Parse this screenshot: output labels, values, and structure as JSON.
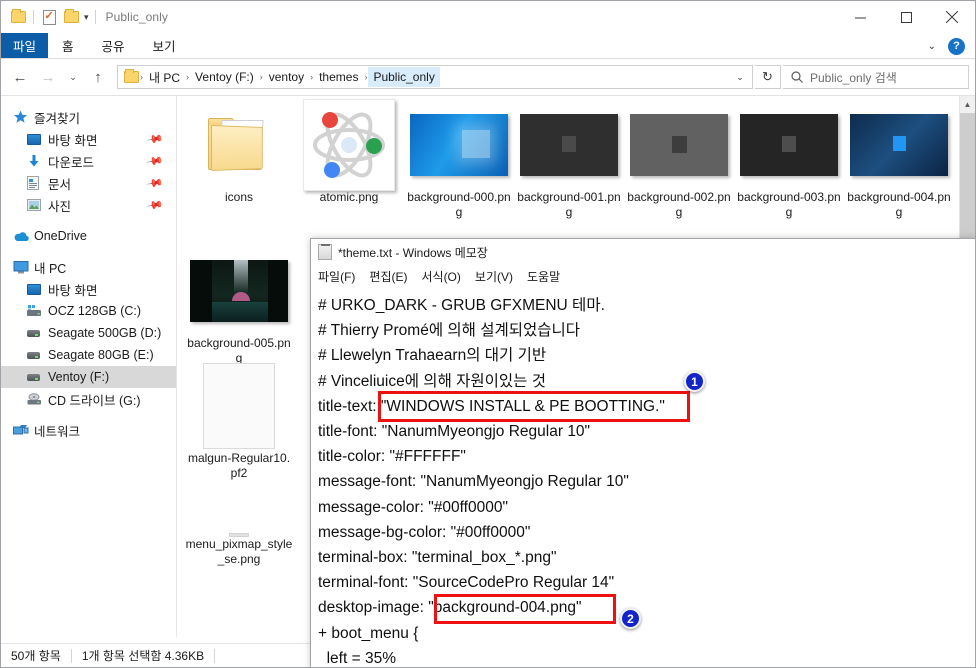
{
  "explorer": {
    "title": "Public_only",
    "quick_access": [
      "folder-icon",
      "properties-icon",
      "new-folder-icon",
      "customize-caret-icon"
    ],
    "window_controls": {
      "minimize": "minimize-icon",
      "maximize": "maximize-icon",
      "close": "close-icon"
    },
    "ribbon_tabs": [
      {
        "label": "파일",
        "active": true
      },
      {
        "label": "홈",
        "active": false
      },
      {
        "label": "공유",
        "active": false
      },
      {
        "label": "보기",
        "active": false
      }
    ],
    "ribbon_help": "?",
    "address": {
      "breadcrumbs": [
        "내 PC",
        "Ventoy (F:)",
        "ventoy",
        "themes",
        "Public_only"
      ],
      "separator": "›",
      "active_index": 4
    },
    "search": {
      "placeholder": "Public_only 검색"
    },
    "sidebar": [
      {
        "label": "즐겨찾기",
        "icon": "star-icon",
        "level": 0,
        "pin": false,
        "selected": false
      },
      {
        "label": "바탕 화면",
        "icon": "desktop-icon",
        "level": 1,
        "pin": true,
        "selected": false
      },
      {
        "label": "다운로드",
        "icon": "download-icon",
        "level": 1,
        "pin": true,
        "selected": false
      },
      {
        "label": "문서",
        "icon": "documents-icon",
        "level": 1,
        "pin": true,
        "selected": false
      },
      {
        "label": "사진",
        "icon": "pictures-icon",
        "level": 1,
        "pin": true,
        "selected": false
      },
      {
        "label": "OneDrive",
        "icon": "onedrive-cloud-icon",
        "level": 0,
        "pin": false,
        "selected": false
      },
      {
        "label": "내 PC",
        "icon": "this-pc-icon",
        "level": 0,
        "pin": false,
        "selected": false
      },
      {
        "label": "바탕 화면",
        "icon": "desktop-icon",
        "level": 1,
        "pin": false,
        "selected": false
      },
      {
        "label": "OCZ 128GB (C:)",
        "icon": "windows-drive-icon",
        "level": 1,
        "pin": false,
        "selected": false
      },
      {
        "label": "Seagate 500GB (D:)",
        "icon": "drive-icon",
        "level": 1,
        "pin": false,
        "selected": false
      },
      {
        "label": "Seagate 80GB (E:)",
        "icon": "drive-icon",
        "level": 1,
        "pin": false,
        "selected": false
      },
      {
        "label": "Ventoy (F:)",
        "icon": "drive-icon",
        "level": 1,
        "pin": false,
        "selected": true
      },
      {
        "label": "CD 드라이브 (G:)",
        "icon": "cd-drive-icon",
        "level": 1,
        "pin": false,
        "selected": false
      },
      {
        "label": "네트워크",
        "icon": "network-icon",
        "level": 0,
        "pin": false,
        "selected": false
      }
    ],
    "files": [
      {
        "name": "icons",
        "kind": "folder"
      },
      {
        "name": "atomic.png",
        "kind": "image-atomic"
      },
      {
        "name": "background-000.png",
        "kind": "image-win-blue"
      },
      {
        "name": "background-001.png",
        "kind": "image-dark1"
      },
      {
        "name": "background-002.png",
        "kind": "image-gray"
      },
      {
        "name": "background-003.png",
        "kind": "image-dark2"
      },
      {
        "name": "background-004.png",
        "kind": "image-navy"
      },
      {
        "name": "background-005.png",
        "kind": "image-cave"
      },
      {
        "name": "malgun-Regular10.pf2",
        "kind": "file-blank"
      },
      {
        "name": "menu_pixmap_style_se.png",
        "kind": "image-thin"
      }
    ],
    "status": {
      "count": "50개 항목",
      "selection": "1개 항목 선택함 4.36KB"
    }
  },
  "notepad": {
    "title": "*theme.txt - Windows 메모장",
    "menu": [
      "파일(F)",
      "편집(E)",
      "서식(O)",
      "보기(V)",
      "도움말"
    ],
    "lines": [
      "# URKO_DARK - GRUB GFXMENU 테마.",
      "# Thierry Promé에 의해 설계되었습니다",
      "# Llewelyn Trahaearn의 대기 기반",
      "# Vinceliuice에 의해 자원이있는 것",
      "",
      "title-text: \"WINDOWS INSTALL & PE BOOTTING.\"",
      "title-font: \"NanumMyeongjo Regular 10\"",
      "title-color: \"#FFFFFF\"",
      "",
      "message-font: \"NanumMyeongjo Regular 10\"",
      "message-color: \"#00ff0000\"",
      "message-bg-color: \"#00ff0000\"",
      "terminal-box: \"terminal_box_*.png\"",
      "terminal-font: \"SourceCodePro Regular 14\"",
      "desktop-image: \"background-004.png\"",
      "",
      "+ boot_menu {",
      "  left = 35%"
    ]
  },
  "annotations": [
    {
      "number": "1",
      "target": "title-text-value",
      "color": "#ee1111"
    },
    {
      "number": "2",
      "target": "desktop-image-value",
      "color": "#ee1111"
    }
  ]
}
